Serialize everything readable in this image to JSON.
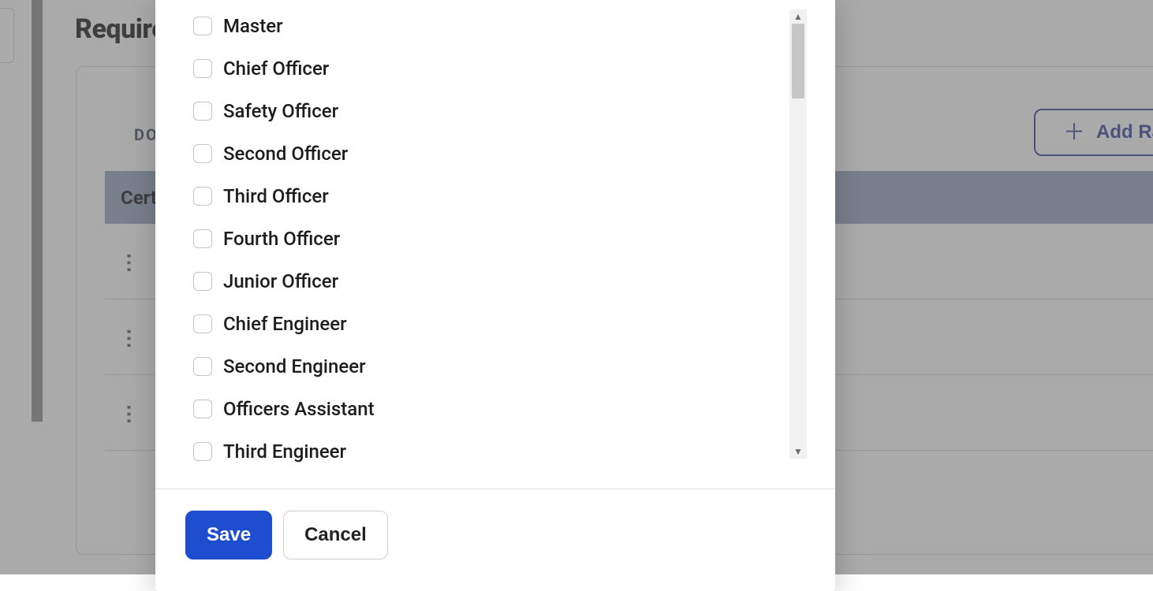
{
  "page": {
    "title_partial": "Require",
    "doc_label": "DO",
    "add_rank_label": "Add Ra",
    "group_label": "Certi"
  },
  "modal": {
    "options": [
      "Master",
      "Chief Officer",
      "Safety Officer",
      "Second Officer",
      "Third Officer",
      "Fourth Officer",
      "Junior Officer",
      "Chief Engineer",
      "Second Engineer",
      "Officers Assistant",
      "Third Engineer"
    ],
    "save_label": "Save",
    "cancel_label": "Cancel"
  }
}
